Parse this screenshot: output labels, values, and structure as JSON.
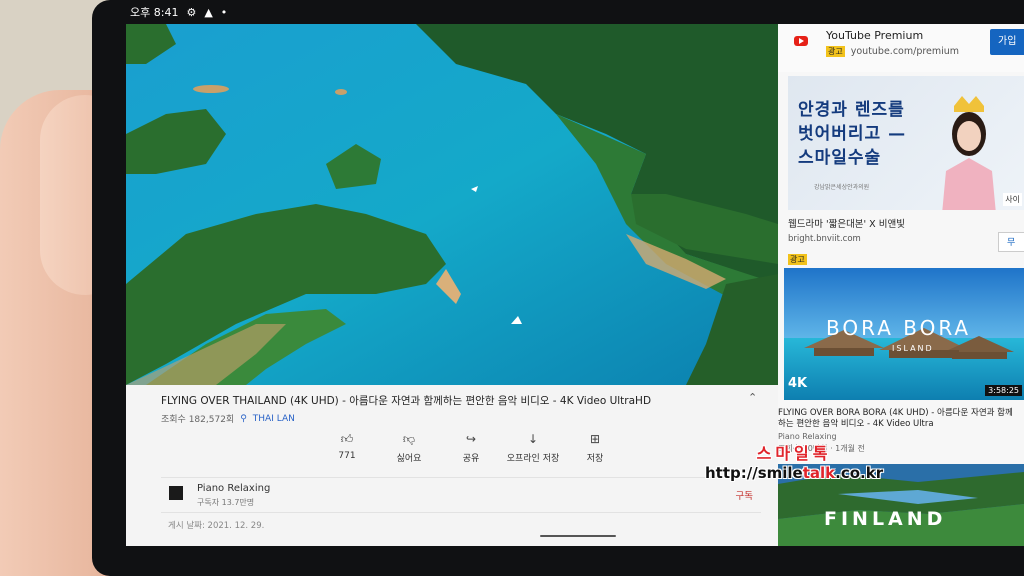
{
  "status_bar": {
    "time": "오후 8:41",
    "icons": [
      "gear-icon",
      "notification-icon",
      "dot-icon"
    ]
  },
  "video": {
    "title": "FLYING OVER THAILAND (4K UHD) - 아름다운 자연과 함께하는 편안한 음악 비디오 - 4K Video UltraHD",
    "views": "조회수 182,572회",
    "location": "THAI LAN"
  },
  "actions": [
    {
      "label": "771",
      "icon": "thumbs-up-icon"
    },
    {
      "label": "싫어요",
      "icon": "thumbs-down-icon"
    },
    {
      "label": "공유",
      "icon": "share-icon"
    },
    {
      "label": "오프라인 저장",
      "icon": "download-icon"
    },
    {
      "label": "저장",
      "icon": "save-icon"
    }
  ],
  "channel": {
    "name": "Piano Relaxing",
    "subscribers": "구독자 13.7만명",
    "subscribe_label": "구독"
  },
  "publish_date": "게시 날짜: 2021. 12. 29.",
  "sidebar": {
    "premium": {
      "title": "YouTube Premium",
      "ad_badge": "광고",
      "url": "youtube.com/premium",
      "join_label": "가입"
    },
    "ad": {
      "text_line1": "안경과 렌즈를",
      "text_line2": "벗어버리고 —",
      "text_line3": "스마일수술",
      "brand": "강남밝은세상안과의원",
      "corner": "사이",
      "caption": "웹드라마 '짧은대본' X 비앤빛",
      "url": "bright.bnviit.com",
      "ad_badge": "광고",
      "open_label": "무"
    },
    "bora": {
      "overlay_title": "BORA BORA",
      "overlay_sub": "ISLAND",
      "quality": "4K",
      "duration": "3:58:25",
      "title": "FLYING OVER BORA BORA (4K UHD) - 아름다운 자연과 함께하는 편안한 음악 비디오 - 4K Video Ultra",
      "channel": "Piano Relaxing",
      "meta": "조회수 10만회 · 1개월 전"
    },
    "finland": {
      "overlay_title": "FINLAND"
    }
  },
  "watermark": {
    "line1": "스마일톡",
    "line2_prefix": "http://smile",
    "line2_highlight": "talk",
    "line2_suffix": ".co.kr"
  }
}
